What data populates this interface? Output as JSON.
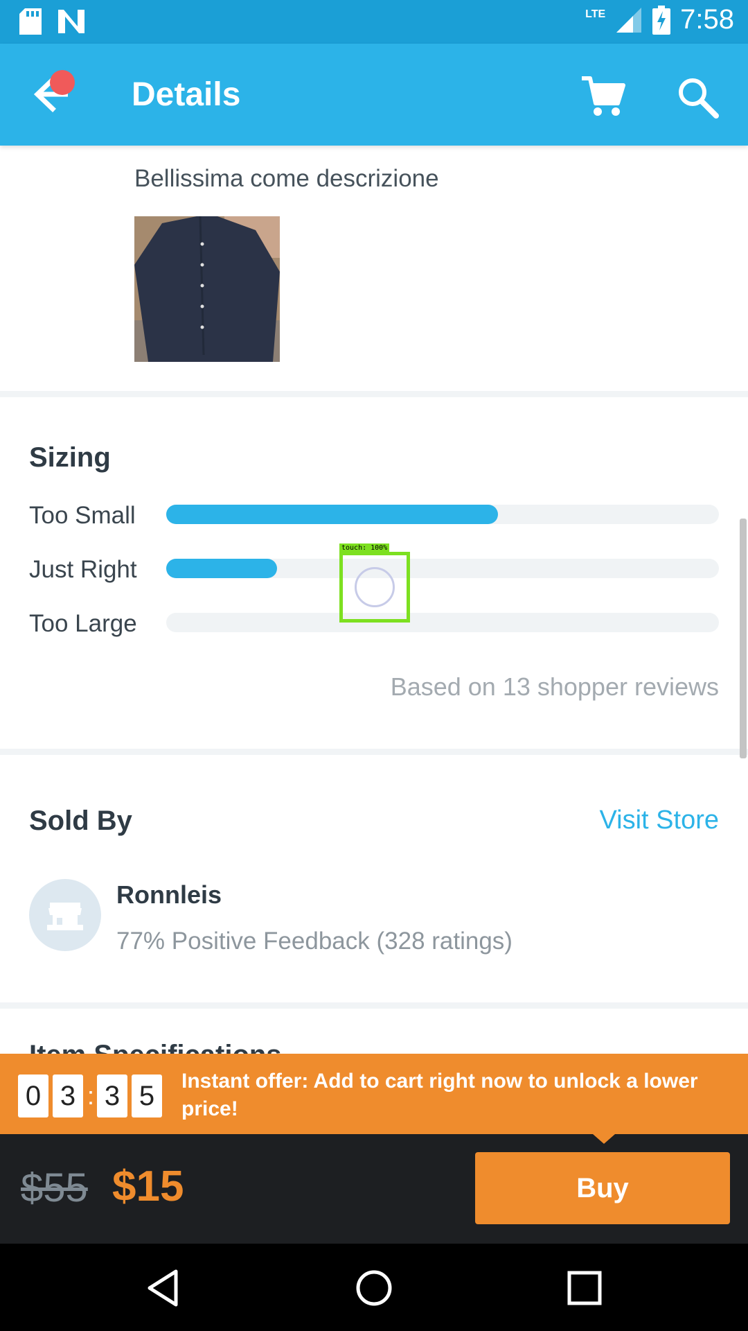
{
  "status_bar": {
    "network": "LTE",
    "time": "7:58"
  },
  "app_bar": {
    "title": "Details"
  },
  "review": {
    "text": "Bellissima come descrizione"
  },
  "sizing": {
    "title": "Sizing",
    "rows": [
      {
        "label": "Too Small",
        "fraction": 0.6
      },
      {
        "label": "Just Right",
        "fraction": 0.2
      },
      {
        "label": "Too Large",
        "fraction": 0.0
      }
    ],
    "based_on": "Based on 13 shopper reviews"
  },
  "seller": {
    "section_title": "Sold By",
    "visit_store": "Visit Store",
    "name": "Ronnleis",
    "feedback": "77% Positive Feedback (328 ratings)"
  },
  "next_section": {
    "title": "Item Specifications"
  },
  "touch_overlay": {
    "label": "touch: 100%"
  },
  "offer": {
    "timer_digits": [
      "0",
      "3",
      "3",
      "5"
    ],
    "separator": ":",
    "text": "Instant offer: Add to cart right now to unlock a lower price!"
  },
  "purchase": {
    "old_price": "$55",
    "new_price": "$15",
    "buy_label": "Buy"
  },
  "colors": {
    "accent_blue": "#2cb3e8",
    "accent_orange": "#ef8c2d",
    "status_blue": "#1b9fd6"
  }
}
